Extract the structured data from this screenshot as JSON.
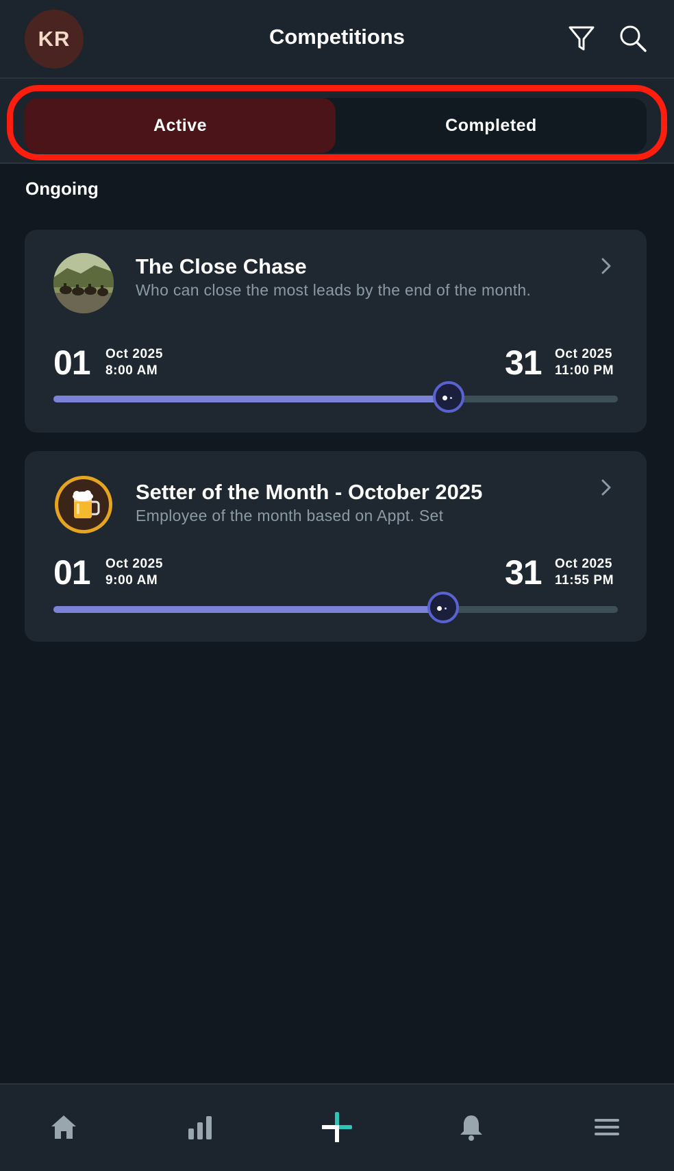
{
  "header": {
    "avatar_initials": "KR",
    "title": "Competitions",
    "icons": [
      "filter-icon",
      "search-icon"
    ]
  },
  "tabs": [
    {
      "label": "Active",
      "selected": true
    },
    {
      "label": "Completed",
      "selected": false
    }
  ],
  "section": {
    "label": "Ongoing"
  },
  "competitions": [
    {
      "title": "The Close Chase",
      "description": "Who can close the most leads by the end of the month.",
      "thumbnail": "horse-race-image",
      "start": {
        "day": "01",
        "month_year": "Oct 2025",
        "time": "8:00 AM"
      },
      "end": {
        "day": "31",
        "month_year": "Oct 2025",
        "time": "11:00 PM"
      },
      "progress": 0.7
    },
    {
      "title": "Setter of the Month - October 2025",
      "description": "Employee of the month based on Appt. Set",
      "thumbnail": "beer-mug-icon",
      "start": {
        "day": "01",
        "month_year": "Oct 2025",
        "time": "9:00 AM"
      },
      "end": {
        "day": "31",
        "month_year": "Oct 2025",
        "time": "11:55 PM"
      },
      "progress": 0.69
    }
  ],
  "bottom_nav": [
    "home-icon",
    "stats-icon",
    "add-icon",
    "bell-icon",
    "menu-icon"
  ],
  "colors": {
    "background": "#111820",
    "header": "#1c252d",
    "card": "#1f2830",
    "tab_active": "#4a1418",
    "highlight": "#ff1d0e",
    "progress_fill": "#7c82d6",
    "progress_track": "#3f4f57",
    "accent_add": "#2ec4b6"
  }
}
